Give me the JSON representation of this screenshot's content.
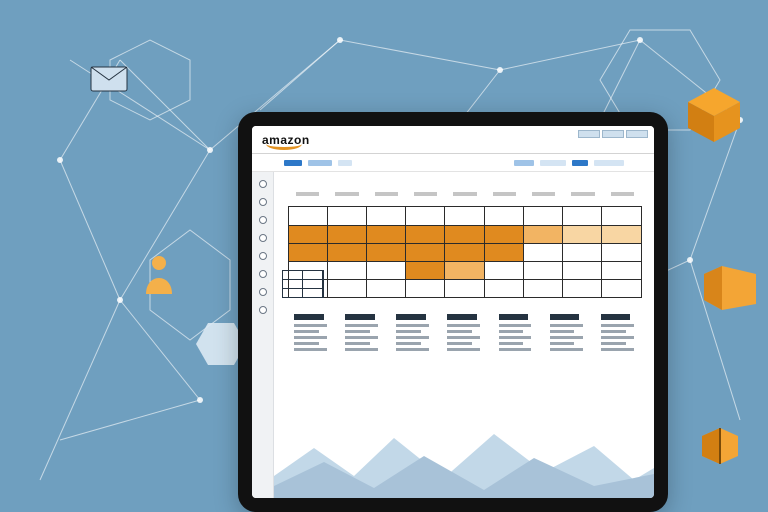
{
  "brand": "amazon",
  "chart_data": {
    "type": "heatmap",
    "grid": [
      [
        0,
        0,
        0,
        0,
        0,
        0,
        0,
        0,
        0
      ],
      [
        3,
        3,
        3,
        3,
        3,
        3,
        2,
        1,
        1
      ],
      [
        3,
        3,
        3,
        3,
        3,
        3,
        0,
        0,
        0
      ],
      [
        0,
        0,
        0,
        3,
        2,
        0,
        0,
        0,
        0
      ],
      [
        0,
        0,
        0,
        0,
        0,
        0,
        0,
        0,
        0
      ]
    ],
    "legend": {
      "0": "empty",
      "1": "pale",
      "2": "light",
      "3": "dark"
    },
    "rows": 5,
    "cols": 9
  },
  "area_chart": {
    "type": "area",
    "note": "decorative mountain silhouette, no labeled values",
    "series": [
      {
        "name": "back",
        "points": [
          0,
          22,
          10,
          38,
          14,
          46,
          20,
          58,
          8,
          30,
          0
        ]
      },
      {
        "name": "front",
        "points": [
          0,
          12,
          4,
          24,
          8,
          34,
          12,
          22,
          2,
          16,
          0
        ]
      }
    ]
  }
}
